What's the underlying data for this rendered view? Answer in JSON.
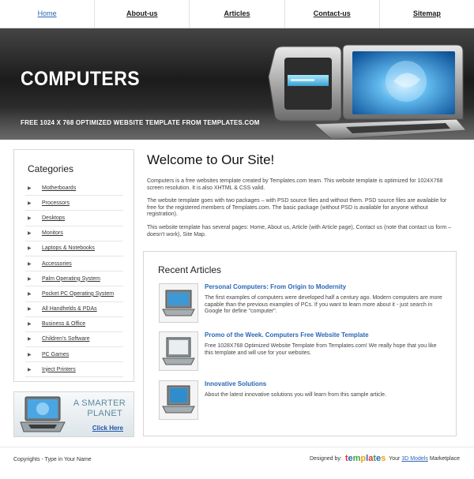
{
  "nav": {
    "items": [
      {
        "label": "Home"
      },
      {
        "label": "About-us"
      },
      {
        "label": "Articles"
      },
      {
        "label": "Contact-us"
      },
      {
        "label": "Sitemap"
      }
    ]
  },
  "header": {
    "title": "COMPUTERS",
    "subtitle": "FREE 1024 X 768 OPTIMIZED WEBSITE TEMPLATE FROM TEMPLATES.COM"
  },
  "sidebar": {
    "heading": "Categories",
    "items": [
      {
        "label": "Motherboards"
      },
      {
        "label": "Processors"
      },
      {
        "label": "Desktops"
      },
      {
        "label": "Monitors"
      },
      {
        "label": "Laptops & Notebooks"
      },
      {
        "label": "Accessories"
      },
      {
        "label": "Palm Operating System"
      },
      {
        "label": "Pocket PC Operating System"
      },
      {
        "label": "All Handhelds & PDAs"
      },
      {
        "label": "Business & Office"
      },
      {
        "label": "Children's Software"
      },
      {
        "label": "PC Games"
      },
      {
        "label": "Inject Printers"
      }
    ]
  },
  "ad": {
    "line1": "A SMARTER",
    "line2": "PLANET",
    "cta": "Click Here"
  },
  "main": {
    "title": "Welcome to Our Site!",
    "p1": "Computers is a free websites template created by Templates.com team. This website template is optimized for 1024X768 screen resolution. It is also XHTML & CSS valid.",
    "p2": "The website template goes with two packages – with PSD source files and without them. PSD source files are available for free for the registered members of Templates.com. The basic package (without PSD is available for anyone without registration).",
    "p3": "This website template has several pages: Home, About us, Article (with Article page), Contact us (note that contact us form – doesn't work), Site Map."
  },
  "recent": {
    "heading": "Recent Articles",
    "articles": [
      {
        "title": "Personal Computers: From Origin to Modernity",
        "body": "The first examples of computers were developed half a century ago. Modern computers are more capable than the previous examples of PCs. If you want to learn more about it - just search in Google for define \"computer\"."
      },
      {
        "title": "Promo of the Week. Computers Free Website Template",
        "body": "Free 1028X768 Optimized Website Template from Templates.com! We really hope that you like this template and will use for your websites."
      },
      {
        "title": "Innovative Solutions",
        "body": "About the latest innovative solutions you will learn from this sample article."
      }
    ]
  },
  "footer": {
    "copyright": "Copyrights - Type in Your Name",
    "designed_by": "Designed by:",
    "logo_text": "templates",
    "your": "Your",
    "link": "3D Models",
    "marketplace": "Marketplace"
  }
}
